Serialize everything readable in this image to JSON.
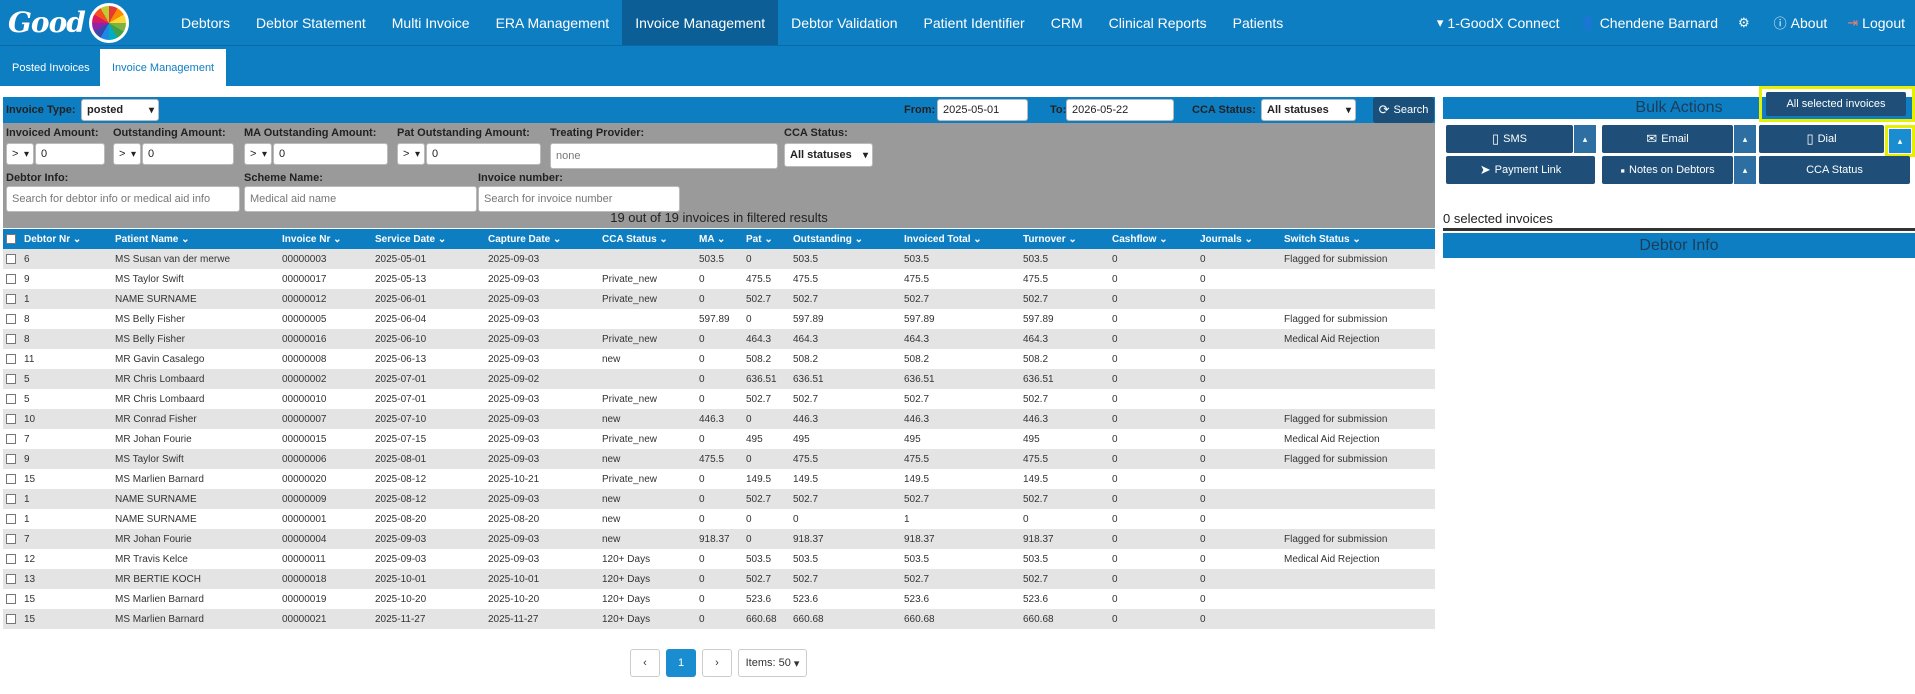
{
  "brand": {
    "name": "Good",
    "logo_icon": "goodx-color-wheel-icon"
  },
  "nav": {
    "items": [
      "Debtors",
      "Debtor Statement",
      "Multi Invoice",
      "ERA Management",
      "Invoice Management",
      "Debtor Validation",
      "Patient Identifier",
      "CRM",
      "Clinical Reports",
      "Patients"
    ],
    "active": "Invoice Management",
    "right": {
      "connect": "1-GoodX Connect",
      "user": "Chendene Barnard",
      "about": "About",
      "logout": "Logout"
    }
  },
  "tabs": {
    "posted": "Posted Invoices",
    "management": "Invoice Management"
  },
  "filters": {
    "invoice_type_label": "Invoice Type:",
    "invoice_type_value": "posted",
    "from_label": "From:",
    "from_value": "2025-05-01",
    "to_label": "To:",
    "to_value": "2026-05-22",
    "cca_status_label": "CCA Status:",
    "cca_status_value": "All statuses",
    "search_label": "Search",
    "invoiced_amount_label": "Invoiced Amount:",
    "outstanding_amount_label": "Outstanding Amount:",
    "ma_outstanding_label": "MA Outstanding Amount:",
    "pat_outstanding_label": "Pat Outstanding Amount:",
    "treating_provider_label": "Treating Provider:",
    "treating_provider_value": "none",
    "cca_status2_label": "CCA Status:",
    "cca_status2_value": "All statuses",
    "op": ">",
    "zero": "0",
    "debtor_info_label": "Debtor Info:",
    "debtor_info_placeholder": "Search for debtor info or medical aid info",
    "scheme_name_label": "Scheme Name:",
    "scheme_name_placeholder": "Medical aid name",
    "invoice_number_label": "Invoice number:",
    "invoice_number_placeholder": "Search for invoice number"
  },
  "results_text": "19 out of 19 invoices in filtered results",
  "table": {
    "headers": [
      "Debtor Nr",
      "Patient Name",
      "Invoice Nr",
      "Service Date",
      "Capture Date",
      "CCA Status",
      "MA",
      "Pat",
      "Outstanding",
      "Invoiced Total",
      "Turnover",
      "Cashflow",
      "Journals",
      "Switch Status"
    ],
    "rows": [
      [
        "6",
        "MS Susan van der merwe",
        "00000003",
        "2025-05-01",
        "2025-09-03",
        "",
        "503.5",
        "0",
        "503.5",
        "503.5",
        "503.5",
        "0",
        "0",
        "Flagged for submission"
      ],
      [
        "9",
        "MS Taylor Swift",
        "00000017",
        "2025-05-13",
        "2025-09-03",
        "Private_new",
        "0",
        "475.5",
        "475.5",
        "475.5",
        "475.5",
        "0",
        "0",
        ""
      ],
      [
        "1",
        "NAME SURNAME",
        "00000012",
        "2025-06-01",
        "2025-09-03",
        "Private_new",
        "0",
        "502.7",
        "502.7",
        "502.7",
        "502.7",
        "0",
        "0",
        ""
      ],
      [
        "8",
        "MS Belly Fisher",
        "00000005",
        "2025-06-04",
        "2025-09-03",
        "",
        "597.89",
        "0",
        "597.89",
        "597.89",
        "597.89",
        "0",
        "0",
        "Flagged for submission"
      ],
      [
        "8",
        "MS Belly Fisher",
        "00000016",
        "2025-06-10",
        "2025-09-03",
        "Private_new",
        "0",
        "464.3",
        "464.3",
        "464.3",
        "464.3",
        "0",
        "0",
        "Medical Aid Rejection"
      ],
      [
        "11",
        "MR Gavin Casalego",
        "00000008",
        "2025-06-13",
        "2025-09-03",
        "new",
        "0",
        "508.2",
        "508.2",
        "508.2",
        "508.2",
        "0",
        "0",
        ""
      ],
      [
        "5",
        "MR Chris Lombaard",
        "00000002",
        "2025-07-01",
        "2025-09-02",
        "",
        "0",
        "636.51",
        "636.51",
        "636.51",
        "636.51",
        "0",
        "0",
        ""
      ],
      [
        "5",
        "MR Chris Lombaard",
        "00000010",
        "2025-07-01",
        "2025-09-03",
        "Private_new",
        "0",
        "502.7",
        "502.7",
        "502.7",
        "502.7",
        "0",
        "0",
        ""
      ],
      [
        "10",
        "MR Conrad Fisher",
        "00000007",
        "2025-07-10",
        "2025-09-03",
        "new",
        "446.3",
        "0",
        "446.3",
        "446.3",
        "446.3",
        "0",
        "0",
        "Flagged for submission"
      ],
      [
        "7",
        "MR Johan Fourie",
        "00000015",
        "2025-07-15",
        "2025-09-03",
        "Private_new",
        "0",
        "495",
        "495",
        "495",
        "495",
        "0",
        "0",
        "Medical Aid Rejection"
      ],
      [
        "9",
        "MS Taylor Swift",
        "00000006",
        "2025-08-01",
        "2025-09-03",
        "new",
        "475.5",
        "0",
        "475.5",
        "475.5",
        "475.5",
        "0",
        "0",
        "Flagged for submission"
      ],
      [
        "15",
        "MS Marlien Barnard",
        "00000020",
        "2025-08-12",
        "2025-10-21",
        "Private_new",
        "0",
        "149.5",
        "149.5",
        "149.5",
        "149.5",
        "0",
        "0",
        ""
      ],
      [
        "1",
        "NAME SURNAME",
        "00000009",
        "2025-08-12",
        "2025-09-03",
        "new",
        "0",
        "502.7",
        "502.7",
        "502.7",
        "502.7",
        "0",
        "0",
        ""
      ],
      [
        "1",
        "NAME SURNAME",
        "00000001",
        "2025-08-20",
        "2025-08-20",
        "new",
        "0",
        "0",
        "0",
        "1",
        "0",
        "0",
        "0",
        ""
      ],
      [
        "7",
        "MR Johan Fourie",
        "00000004",
        "2025-09-03",
        "2025-09-03",
        "new",
        "918.37",
        "0",
        "918.37",
        "918.37",
        "918.37",
        "0",
        "0",
        "Flagged for submission"
      ],
      [
        "12",
        "MR Travis Kelce",
        "00000011",
        "2025-09-03",
        "2025-09-03",
        "120+ Days",
        "0",
        "503.5",
        "503.5",
        "503.5",
        "503.5",
        "0",
        "0",
        "Medical Aid Rejection"
      ],
      [
        "13",
        "MR BERTIE KOCH",
        "00000018",
        "2025-10-01",
        "2025-10-01",
        "120+ Days",
        "0",
        "502.7",
        "502.7",
        "502.7",
        "502.7",
        "0",
        "0",
        ""
      ],
      [
        "15",
        "MS Marlien Barnard",
        "00000019",
        "2025-10-20",
        "2025-10-20",
        "120+ Days",
        "0",
        "523.6",
        "523.6",
        "523.6",
        "523.6",
        "0",
        "0",
        ""
      ],
      [
        "15",
        "MS Marlien Barnard",
        "00000021",
        "2025-11-27",
        "2025-11-27",
        "120+ Days",
        "0",
        "660.68",
        "660.68",
        "660.68",
        "660.68",
        "0",
        "0",
        ""
      ]
    ]
  },
  "pagination": {
    "prev": "‹",
    "page": "1",
    "next": "›",
    "items": "Items: 50"
  },
  "bulk": {
    "title": "Bulk Actions",
    "all_selected": "All selected invoices",
    "sms": "SMS",
    "email": "Email",
    "dial": "Dial",
    "payment_link": "Payment Link",
    "notes": "Notes on Debtors",
    "cca_status": "CCA Status",
    "selected_count": "0 selected invoices",
    "debtor_info": "Debtor Info"
  },
  "colors": {
    "primary": "#0e7ec2",
    "dark_button": "#1f4f78",
    "highlight": "#e6f000"
  }
}
